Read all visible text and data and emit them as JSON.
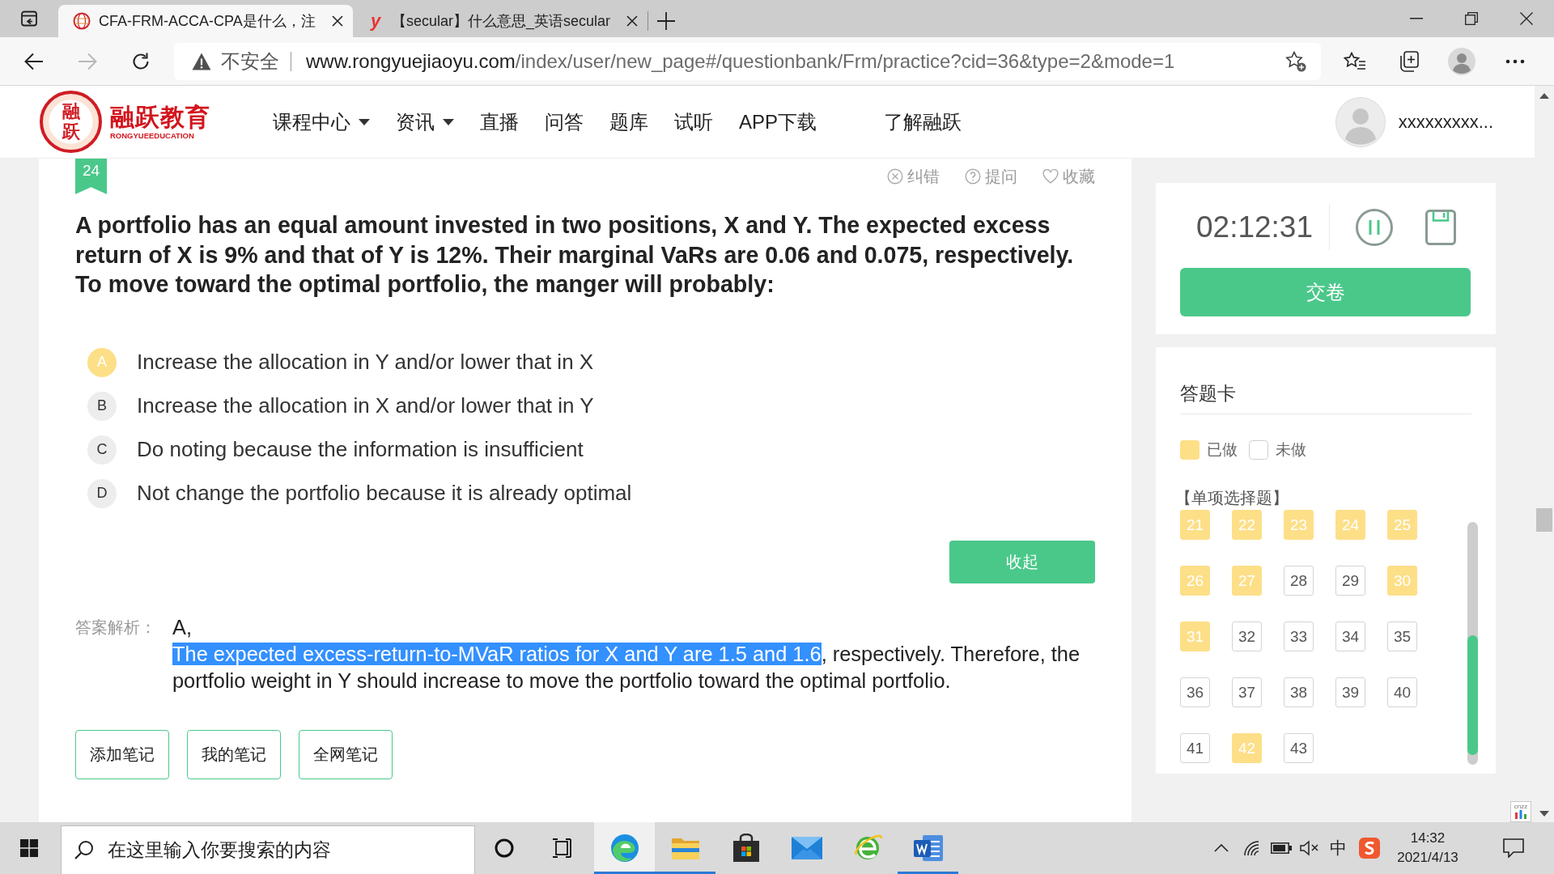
{
  "browser": {
    "tabs": [
      {
        "title": "CFA-FRM-ACCA-CPA是什么，注",
        "selected": true,
        "favicon": {
          "kind": "emblem"
        }
      },
      {
        "title": "【secular】什么意思_英语secular",
        "selected": false,
        "favicon": {
          "kind": "letter",
          "letter": "y"
        }
      }
    ],
    "nav_buttons": [
      {
        "kind": "back",
        "disabled": false
      },
      {
        "kind": "forward",
        "disabled": true
      },
      {
        "kind": "reload",
        "disabled": false
      }
    ],
    "address": {
      "security_label": "不安全",
      "host": "www.rongyuejiaoyu.com",
      "path": "/index/user/new_page#/questionbank/Frm/practice?cid=36&type=2&mode=1"
    }
  },
  "site_header": {
    "logo": {
      "emblem_text": "融跃",
      "name": "融跃教育",
      "tagline": "RONGYUEEDUCATION"
    },
    "nav": [
      {
        "label": "课程中心",
        "dropdown": true
      },
      {
        "label": "资讯",
        "dropdown": true
      },
      {
        "label": "直播",
        "dropdown": false
      },
      {
        "label": "问答",
        "dropdown": false
      },
      {
        "label": "题库",
        "dropdown": false
      },
      {
        "label": "试听",
        "dropdown": false
      },
      {
        "label": "APP下载",
        "dropdown": false
      },
      {
        "label": "了解融跃",
        "dropdown": false
      }
    ],
    "username": "xxxxxxxxx..."
  },
  "question": {
    "number": "24",
    "actions": [
      {
        "label": "纠错",
        "kind": "report"
      },
      {
        "label": "提问",
        "kind": "ask"
      },
      {
        "label": "收藏",
        "kind": "favorite"
      }
    ],
    "text": "A portfolio has an equal amount invested in two positions, X and Y. The expected excess return of X is 9% and that of Y is 12%. Their marginal VaRs are 0.06 and 0.075, respectively. To move toward the optimal portfolio, the manger will probably:",
    "options": [
      {
        "letter": "A",
        "text": "Increase the allocation in Y and/or lower that in X",
        "selected": true
      },
      {
        "letter": "B",
        "text": "Increase the allocation in X and/or lower that in Y",
        "selected": false
      },
      {
        "letter": "C",
        "text": "Do noting because the information is insufficient",
        "selected": false
      },
      {
        "letter": "D",
        "text": "Not change the portfolio because it is already optimal",
        "selected": false
      }
    ],
    "collapse_button": "收起",
    "analysis": {
      "label": "答案解析：",
      "answer": "A,",
      "explanation": [
        {
          "text": "The expected excess-return-to-MVaR ratios for X and Y are 1.5 and 1.6",
          "highlighted": true
        },
        {
          "text": ", respectively. Therefore, the portfolio weight in Y should increase to move the portfolio toward the optimal portfolio.",
          "highlighted": false
        }
      ]
    },
    "note_buttons": [
      "添加笔记",
      "我的笔记",
      "全网笔记"
    ]
  },
  "timer": {
    "time": "02:12:31",
    "submit_button": "交卷"
  },
  "answer_card": {
    "title": "答题卡",
    "legend": [
      {
        "label": "已做",
        "kind": "done"
      },
      {
        "label": "未做",
        "kind": "todo"
      }
    ],
    "section": "【单项选择题】",
    "questions": [
      {
        "number": "21",
        "done": true
      },
      {
        "number": "22",
        "done": true
      },
      {
        "number": "23",
        "done": true
      },
      {
        "number": "24",
        "done": true
      },
      {
        "number": "25",
        "done": true
      },
      {
        "number": "26",
        "done": true
      },
      {
        "number": "27",
        "done": true
      },
      {
        "number": "28",
        "done": false
      },
      {
        "number": "29",
        "done": false
      },
      {
        "number": "30",
        "done": true
      },
      {
        "number": "31",
        "done": true
      },
      {
        "number": "32",
        "done": false
      },
      {
        "number": "33",
        "done": false
      },
      {
        "number": "34",
        "done": false
      },
      {
        "number": "35",
        "done": false
      },
      {
        "number": "36",
        "done": false
      },
      {
        "number": "37",
        "done": false
      },
      {
        "number": "38",
        "done": false
      },
      {
        "number": "39",
        "done": false
      },
      {
        "number": "40",
        "done": false
      },
      {
        "number": "41",
        "done": false
      },
      {
        "number": "42",
        "done": true
      },
      {
        "number": "43",
        "done": false
      }
    ]
  },
  "stats_badge": {
    "label": "cnzz"
  },
  "taskbar": {
    "search": {
      "placeholder": "在这里输入你要搜索的内容"
    },
    "apps": [
      {
        "kind": "browser",
        "running": true,
        "selected": true
      },
      {
        "kind": "folder",
        "running": true,
        "selected": false
      },
      {
        "kind": "store",
        "running": false,
        "selected": false
      },
      {
        "kind": "mail",
        "running": false,
        "selected": false
      },
      {
        "kind": "globe",
        "running": false,
        "selected": false
      },
      {
        "kind": "document",
        "running": true,
        "selected": false
      }
    ],
    "tray": {
      "volume_muted": true,
      "input_method": "中",
      "time": "14:32",
      "date": "2021/4/13"
    }
  }
}
